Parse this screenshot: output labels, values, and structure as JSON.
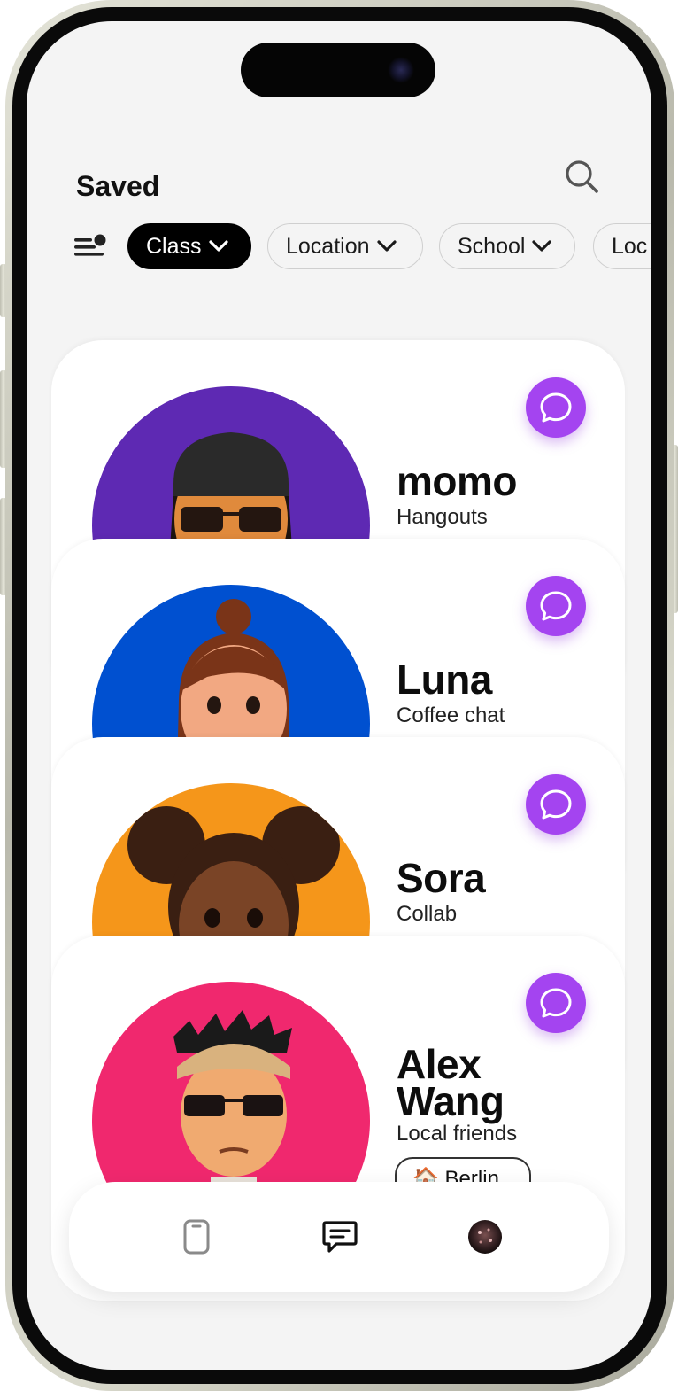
{
  "header": {
    "title": "Saved"
  },
  "icons": {
    "search": "search-icon",
    "filter": "filter-list-icon",
    "chat": "chat-bubble-icon"
  },
  "filters": [
    {
      "label": "Class",
      "active": true
    },
    {
      "label": "Location",
      "active": false
    },
    {
      "label": "School",
      "active": false
    },
    {
      "label": "Loc",
      "active": false
    }
  ],
  "profiles": [
    {
      "name": "momo",
      "tag": "Hangouts",
      "bg": "#5e29b3"
    },
    {
      "name": "Luna",
      "tag": "Coffee chat",
      "bg": "#0050d0"
    },
    {
      "name": "Sora",
      "tag": "Collab",
      "bg": "#f5961a"
    },
    {
      "name": "Alex Wang",
      "tag": "Local friends",
      "bg": "#f0286e",
      "location": "🏠 Berlin"
    }
  ],
  "colors": {
    "accent": "#a444f0",
    "active_chip": "#000000",
    "background": "#f4f4f4"
  },
  "tabbar": {
    "tabs": [
      "phone-icon",
      "messages-icon",
      "profile-avatar"
    ],
    "active": 1
  }
}
